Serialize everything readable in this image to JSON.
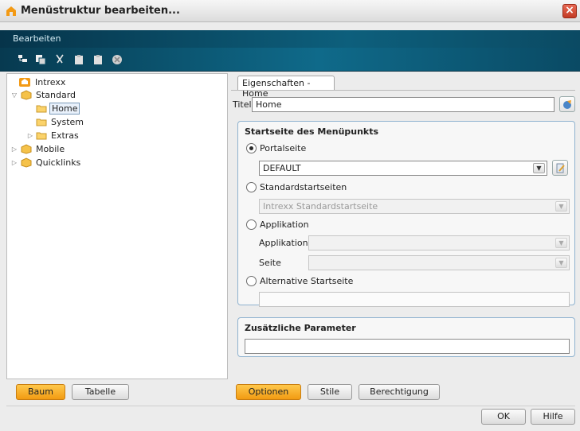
{
  "window": {
    "title": "Menüstruktur bearbeiten..."
  },
  "menubar": {
    "items": [
      "Bearbeiten"
    ]
  },
  "toolbar": {
    "icons": [
      "tree-add-icon",
      "copy-icon",
      "cut-icon",
      "paste-icon",
      "paste-icon",
      "delete-icon"
    ]
  },
  "tree": {
    "items": [
      {
        "label": "Intrexx",
        "level": 0,
        "toggle": "",
        "icon": "portal-icon"
      },
      {
        "label": "Standard",
        "level": 1,
        "toggle": "▽",
        "icon": "package-icon"
      },
      {
        "label": "Home",
        "level": 2,
        "toggle": "",
        "icon": "folder-icon",
        "selected": true
      },
      {
        "label": "System",
        "level": 2,
        "toggle": "",
        "icon": "folder-icon"
      },
      {
        "label": "Extras",
        "level": 2,
        "toggle": "▷",
        "icon": "folder-icon"
      },
      {
        "label": "Mobile",
        "level": 1,
        "toggle": "▷",
        "icon": "package-icon"
      },
      {
        "label": "Quicklinks",
        "level": 1,
        "toggle": "▷",
        "icon": "package-icon"
      }
    ]
  },
  "left_buttons": {
    "tree": "Baum",
    "table": "Tabelle"
  },
  "props": {
    "tab": "Eigenschaften - Home",
    "title_label": "Titel",
    "title_value": "Home",
    "start_group": "Startseite des Menüpunkts",
    "portal_radio": "Portalseite",
    "portal_select": "DEFAULT",
    "standard_radio": "Standardstartseiten",
    "standard_select": "Intrexx Standardstartseite",
    "app_radio": "Applikation",
    "app_label": "Applikation",
    "app_select": "",
    "page_label": "Seite",
    "page_select": "",
    "alt_radio": "Alternative Startseite",
    "alt_value": "",
    "params_group": "Zusätzliche Parameter",
    "params_value": ""
  },
  "right_buttons": {
    "options": "Optionen",
    "style": "Stile",
    "permissions": "Berechtigung"
  },
  "footer": {
    "ok": "OK",
    "help": "Hilfe"
  },
  "colors": {
    "accent_orange": "#f29b12",
    "banner_dark": "#06344a",
    "banner_light": "#0f6a8a"
  }
}
